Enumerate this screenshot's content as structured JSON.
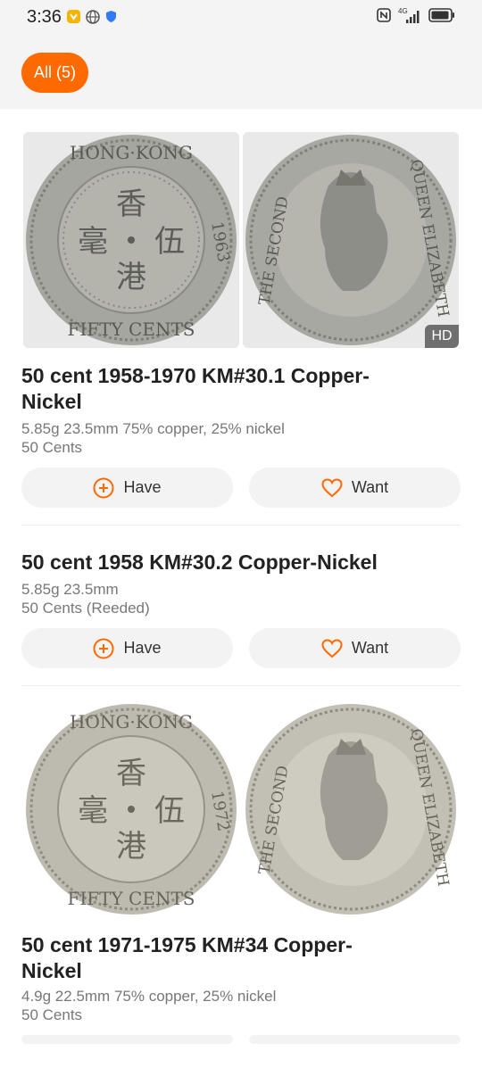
{
  "status": {
    "time": "3:36",
    "network": "4G"
  },
  "filter": {
    "all_label": "All (5)"
  },
  "items": [
    {
      "title_line1": "50 cent  1958-1970  KM#30.1  Copper-",
      "title_line2": "Nickel",
      "meta1": "5.85g  23.5mm  75% copper, 25% nickel",
      "meta2": "50 Cents",
      "hd_label": "HD",
      "have_label": "Have",
      "want_label": "Want",
      "obverse": {
        "top": "HONG·KONG",
        "bottom": "FIFTY CENTS",
        "year": "1963"
      },
      "reverse": {
        "legend_left": "THE SECOND",
        "legend_right": "QUEEN ELIZABETH"
      }
    },
    {
      "title_line1": "50 cent  1958  KM#30.2  Copper-Nickel",
      "meta1": "5.85g  23.5mm",
      "meta2": "50 Cents (Reeded)",
      "have_label": "Have",
      "want_label": "Want"
    },
    {
      "title_line1": "50 cent  1971-1975  KM#34  Copper-",
      "title_line2": "Nickel",
      "meta1": "4.9g  22.5mm  75% copper, 25% nickel",
      "meta2": "50 Cents",
      "obverse": {
        "top": "HONG·KONG",
        "bottom": "FIFTY CENTS",
        "year": "1972"
      },
      "reverse": {
        "legend_left": "THE SECOND",
        "legend_right": "QUEEN ELIZABETH"
      }
    }
  ],
  "colors": {
    "accent": "#ff6a00",
    "chip_text": "#ffffff"
  }
}
